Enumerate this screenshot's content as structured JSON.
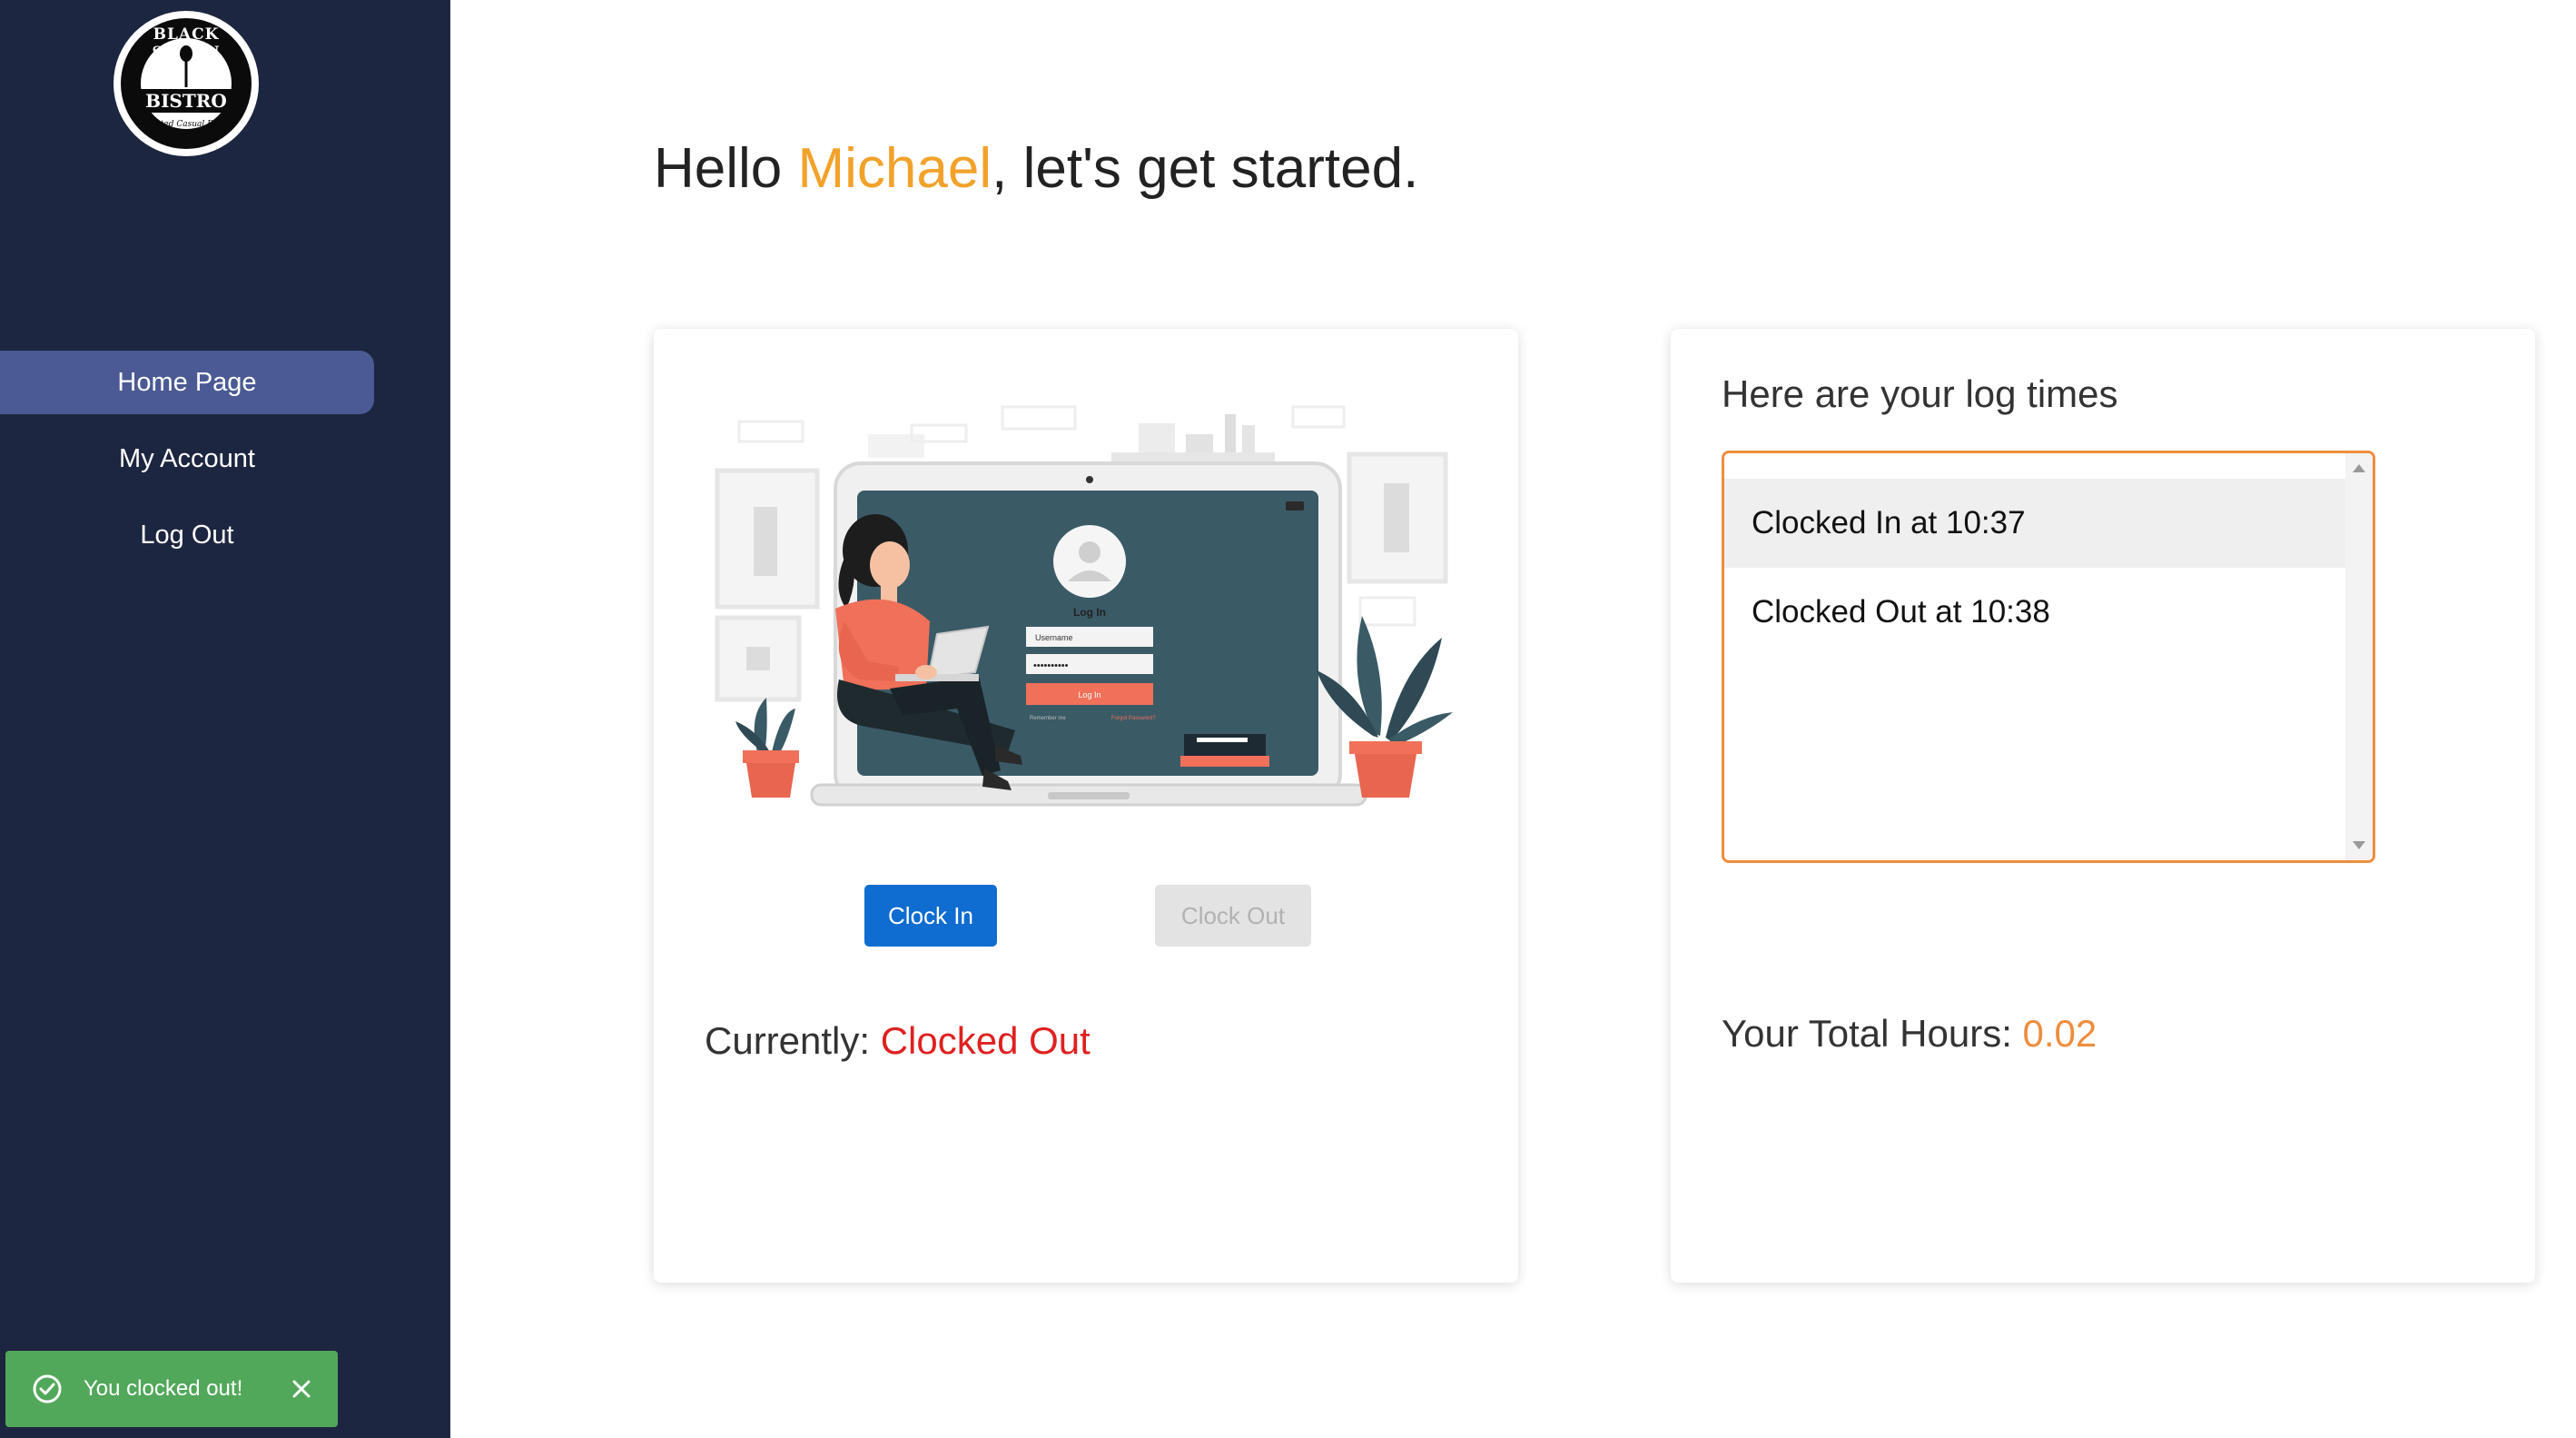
{
  "brand": {
    "logo_top": "BLACK SPOON",
    "logo_mid": "BISTRO",
    "logo_tagline": "Elevated Casual Dining"
  },
  "sidebar": {
    "items": [
      {
        "label": "Home Page",
        "active": true
      },
      {
        "label": "My Account",
        "active": false
      },
      {
        "label": "Log Out",
        "active": false
      }
    ]
  },
  "greeting": {
    "prefix": "Hello ",
    "name": "Michael",
    "suffix": ", let's get started."
  },
  "illustration": {
    "screen_title": "Log In",
    "username_placeholder": "Username",
    "password_mask": "••••••••••",
    "login_button": "Log In",
    "remember": "Remember me",
    "forgot": "Forgot Password?"
  },
  "actions": {
    "clock_in": "Clock In",
    "clock_out": "Clock Out"
  },
  "status": {
    "label": "Currently: ",
    "value": "Clocked Out"
  },
  "log": {
    "title": "Here are your log times",
    "entries": [
      "Clocked In at 10:37",
      "Clocked Out at 10:38"
    ]
  },
  "total": {
    "label": "Your Total Hours: ",
    "value": "0.02"
  },
  "toast": {
    "message": "You clocked out!"
  },
  "colors": {
    "sidebar_bg": "#1d2640",
    "nav_active": "#4b5a94",
    "accent_name": "#f2a22b",
    "accent_orange": "#ee8d3e",
    "status_red": "#e02020",
    "primary_blue": "#0f6cd0",
    "toast_green": "#52a85a"
  },
  "icons": [
    "check-circle-icon",
    "close-icon",
    "scroll-up-icon",
    "scroll-down-icon"
  ]
}
